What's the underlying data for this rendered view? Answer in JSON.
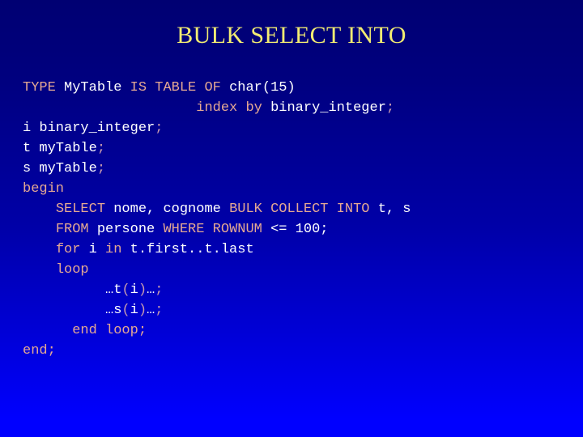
{
  "slide": {
    "title": "BULK SELECT INTO",
    "title_color": "#f2ec72",
    "background_top_color": "#000072",
    "background_bottom_color": "#0000ff",
    "keyword_color": "#e4a893",
    "identifier_color": "#ffffff",
    "punctuation_color": "#c79aae"
  },
  "code": {
    "language": "PL/SQL",
    "lines": [
      {
        "indent": 0,
        "text": "TYPE MyTable IS TABLE OF char(15)",
        "tokens": [
          {
            "t": "TYPE",
            "k": "kw"
          },
          {
            "t": " ",
            "k": "id"
          },
          {
            "t": "MyTable",
            "k": "id"
          },
          {
            "t": " ",
            "k": "id"
          },
          {
            "t": "IS",
            "k": "kw"
          },
          {
            "t": " ",
            "k": "id"
          },
          {
            "t": "TABLE",
            "k": "kw"
          },
          {
            "t": " ",
            "k": "id"
          },
          {
            "t": "OF",
            "k": "kw"
          },
          {
            "t": " ",
            "k": "id"
          },
          {
            "t": "char(15)",
            "k": "id"
          }
        ]
      },
      {
        "indent": 21,
        "text": "index by binary_integer;",
        "tokens": [
          {
            "t": "index",
            "k": "kw"
          },
          {
            "t": " ",
            "k": "id"
          },
          {
            "t": "by",
            "k": "kw"
          },
          {
            "t": " ",
            "k": "id"
          },
          {
            "t": "binary_integer",
            "k": "id"
          },
          {
            "t": ";",
            "k": "pn"
          }
        ]
      },
      {
        "indent": 0,
        "text": "i binary_integer;",
        "tokens": [
          {
            "t": "i binary_integer",
            "k": "id"
          },
          {
            "t": ";",
            "k": "pn"
          }
        ]
      },
      {
        "indent": 0,
        "text": "t myTable;",
        "tokens": [
          {
            "t": "t myTable",
            "k": "id"
          },
          {
            "t": ";",
            "k": "pn"
          }
        ]
      },
      {
        "indent": 0,
        "text": "s myTable;",
        "tokens": [
          {
            "t": "s myTable",
            "k": "id"
          },
          {
            "t": ";",
            "k": "pn"
          }
        ]
      },
      {
        "indent": 0,
        "text": "begin",
        "tokens": [
          {
            "t": "begin",
            "k": "kw"
          }
        ]
      },
      {
        "indent": 4,
        "text": "SELECT nome, cognome BULK COLLECT INTO t, s",
        "tokens": [
          {
            "t": "SELECT",
            "k": "kw"
          },
          {
            "t": " ",
            "k": "id"
          },
          {
            "t": "nome, cognome",
            "k": "id"
          },
          {
            "t": " ",
            "k": "id"
          },
          {
            "t": "BULK COLLECT INTO",
            "k": "kw"
          },
          {
            "t": " ",
            "k": "id"
          },
          {
            "t": "t, s",
            "k": "id"
          }
        ]
      },
      {
        "indent": 4,
        "text": "FROM persone WHERE ROWNUM <= 100;",
        "tokens": [
          {
            "t": "FROM",
            "k": "kw"
          },
          {
            "t": " ",
            "k": "id"
          },
          {
            "t": "persone",
            "k": "id"
          },
          {
            "t": " ",
            "k": "id"
          },
          {
            "t": "WHERE ROWNUM",
            "k": "kw"
          },
          {
            "t": " ",
            "k": "id"
          },
          {
            "t": "<= 100;",
            "k": "id"
          }
        ]
      },
      {
        "indent": 4,
        "text": "for i in t.first..t.last",
        "tokens": [
          {
            "t": "for",
            "k": "kw"
          },
          {
            "t": " ",
            "k": "id"
          },
          {
            "t": "i",
            "k": "id"
          },
          {
            "t": " ",
            "k": "id"
          },
          {
            "t": "in",
            "k": "kw"
          },
          {
            "t": " ",
            "k": "id"
          },
          {
            "t": "t.first..t.last",
            "k": "id"
          }
        ]
      },
      {
        "indent": 4,
        "text": "loop",
        "tokens": [
          {
            "t": "loop",
            "k": "kw"
          }
        ]
      },
      {
        "indent": 10,
        "text": "…t(i)…;",
        "tokens": [
          {
            "t": "…t",
            "k": "id"
          },
          {
            "t": "(",
            "k": "pn"
          },
          {
            "t": "i",
            "k": "id"
          },
          {
            "t": ")",
            "k": "pn"
          },
          {
            "t": "…",
            "k": "id"
          },
          {
            "t": ";",
            "k": "pn"
          }
        ]
      },
      {
        "indent": 10,
        "text": "…s(i)…;",
        "tokens": [
          {
            "t": "…s",
            "k": "id"
          },
          {
            "t": "(",
            "k": "pn"
          },
          {
            "t": "i",
            "k": "id"
          },
          {
            "t": ")",
            "k": "pn"
          },
          {
            "t": "…",
            "k": "id"
          },
          {
            "t": ";",
            "k": "pn"
          }
        ]
      },
      {
        "indent": 6,
        "text": "end loop;",
        "tokens": [
          {
            "t": "end loop;",
            "k": "kw"
          }
        ]
      },
      {
        "indent": 0,
        "text": "end;",
        "tokens": [
          {
            "t": "end;",
            "k": "kw"
          }
        ]
      }
    ]
  }
}
